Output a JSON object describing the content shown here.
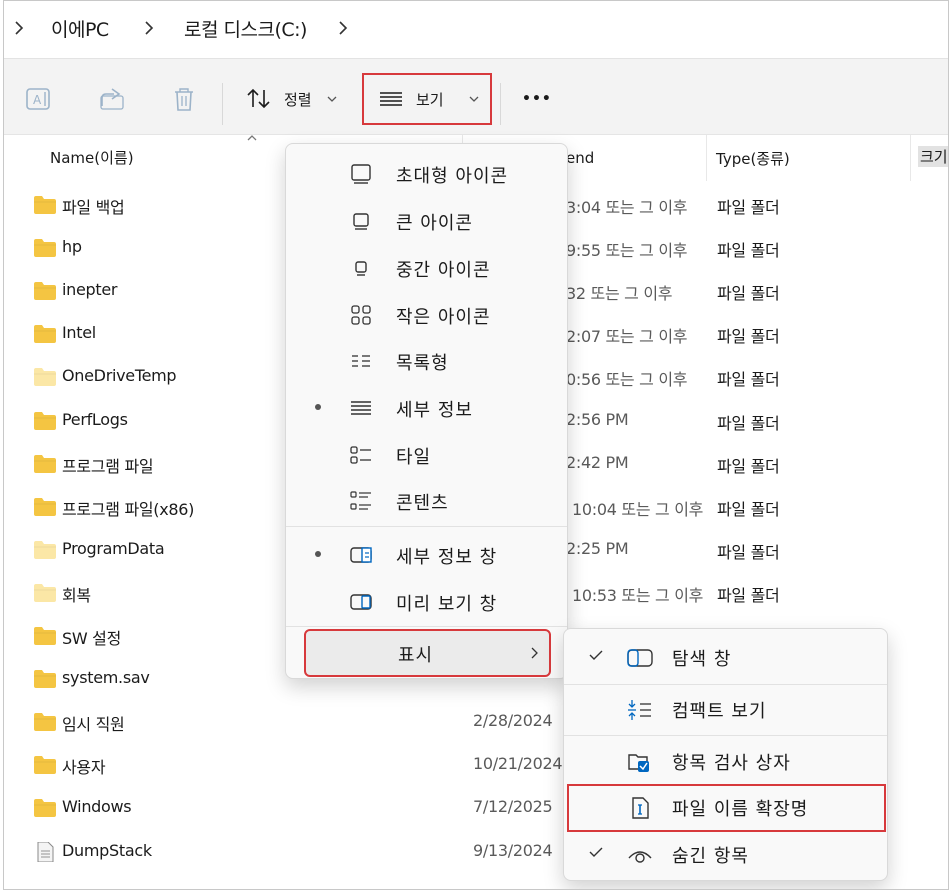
{
  "breadcrumb": {
    "items": [
      "이에PC",
      "로컬  디스크(C:)"
    ]
  },
  "toolbar": {
    "sort_label": "정렬",
    "view_label": "보기",
    "more_label": "•••"
  },
  "columns": {
    "name": "Name(이름)",
    "date": "end",
    "type": "Type(종류)",
    "size": "크기"
  },
  "files": [
    {
      "name": "파일 백업",
      "date": "3:04 또는 그 이후",
      "type": "파일 폴더"
    },
    {
      "name": "hp",
      "date": "9:55 또는 그 이후",
      "type": "파일 폴더"
    },
    {
      "name": "inepter",
      "date": "32 또는 그 이후",
      "type": "파일 폴더"
    },
    {
      "name": "Intel",
      "date": "2:07 또는 그 이후",
      "type": "파일 폴더"
    },
    {
      "name": "OneDriveTemp",
      "date": "0:56 또는 그 이후",
      "type": "파일 폴더"
    },
    {
      "name": "PerfLogs",
      "date": "2:56 PM",
      "type": "파일 폴더"
    },
    {
      "name": "프로그램 파일",
      "date": "2:42 PM",
      "type": "파일 폴더"
    },
    {
      "name": "프로그램 파일(x86)",
      "date": "10:04 또는 그 이후",
      "type": "파일 폴더"
    },
    {
      "name": "ProgramData",
      "date": "2:25 PM",
      "type": "파일 폴더"
    },
    {
      "name": "회복",
      "date": "10:53 또는 그 이후",
      "type": "파일 폴더"
    },
    {
      "name": "SW 설정",
      "date": "",
      "type": ""
    },
    {
      "name": "system.sav",
      "date": "",
      "type": ""
    },
    {
      "name": "임시 직원",
      "date": "2/28/2024",
      "type": ""
    },
    {
      "name": "사용자",
      "date": "10/21/2024",
      "type": ""
    },
    {
      "name": "Windows",
      "date": "7/12/2025",
      "type": ""
    },
    {
      "name": "DumpStack",
      "date": "9/13/2024",
      "type": ""
    }
  ],
  "view_menu": {
    "items": [
      {
        "label": "초대형 아이콘",
        "icon": "extra-large-icons-icon"
      },
      {
        "label": "큰 아이콘",
        "icon": "large-icons-icon"
      },
      {
        "label": "중간 아이콘",
        "icon": "medium-icons-icon"
      },
      {
        "label": "작은 아이콘",
        "icon": "small-icons-icon"
      },
      {
        "label": "목록형",
        "icon": "list-icon"
      },
      {
        "label": "세부 정보",
        "icon": "details-icon",
        "selected": true
      },
      {
        "label": "타일",
        "icon": "tiles-icon"
      },
      {
        "label": "콘텐츠",
        "icon": "content-icon"
      }
    ],
    "panes": [
      {
        "label": "세부 정보 창",
        "icon": "details-pane-icon",
        "selected": true
      },
      {
        "label": "미리 보기 창",
        "icon": "preview-pane-icon"
      }
    ],
    "show_label": "표시"
  },
  "show_menu": {
    "items": [
      {
        "label": "탐색 창",
        "icon": "navigation-pane-icon",
        "checked": true
      },
      {
        "label": "컴팩트 보기",
        "icon": "compact-view-icon"
      },
      {
        "label": "항목 검사 상자",
        "icon": "item-checkbox-icon"
      },
      {
        "label": "파일 이름 확장명",
        "icon": "file-extension-icon",
        "highlighted": true
      },
      {
        "label": "숨긴 항목",
        "icon": "hidden-items-icon",
        "checked": true
      }
    ]
  },
  "colors": {
    "highlight": "#d7393c",
    "folder": "#f4c542",
    "folder_light": "#fbe7a6",
    "accent": "#0067c0"
  }
}
